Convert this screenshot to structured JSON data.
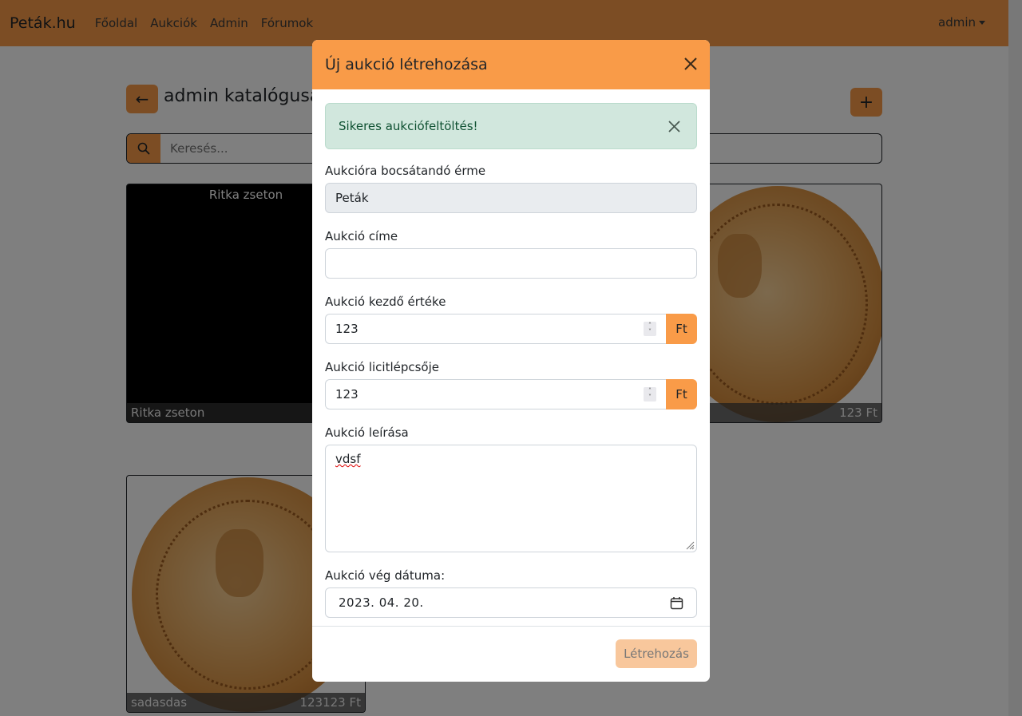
{
  "navbar": {
    "brand": "Peták.hu",
    "links": [
      "Főoldal",
      "Aukciók",
      "Admin",
      "Fórumok"
    ],
    "user": "admin"
  },
  "page": {
    "title": "admin katalógusa",
    "back_icon": "arrow-left-icon",
    "add_icon": "plus-icon",
    "search_placeholder": "Keresés..."
  },
  "cards": [
    {
      "top_title": "Ritka zseton",
      "name": "Ritka zseton",
      "price": ""
    },
    {
      "name": "",
      "price": "123 Ft"
    },
    {
      "name": "sadasdas",
      "price": "123123 Ft"
    }
  ],
  "modal": {
    "title": "Új aukció létrehozása",
    "alert": "Sikeres aukciófeltöltés!",
    "coin_label": "Aukcióra bocsátandó érme",
    "coin_value": "Peták",
    "title_label": "Aukció címe",
    "title_value": "",
    "start_label": "Aukció kezdő értéke",
    "start_value": "123",
    "step_label": "Aukció licitlépcsője",
    "step_value": "123",
    "currency": "Ft",
    "desc_label": "Aukció leírása",
    "desc_value": "vdsf",
    "end_label": "Aukció vég dátuma:",
    "end_value": "2023. 04. 20.",
    "submit": "Létrehozás"
  },
  "colors": {
    "accent": "#f99b48",
    "alert_bg": "#d1e7dd",
    "alert_text": "#0f5132"
  }
}
